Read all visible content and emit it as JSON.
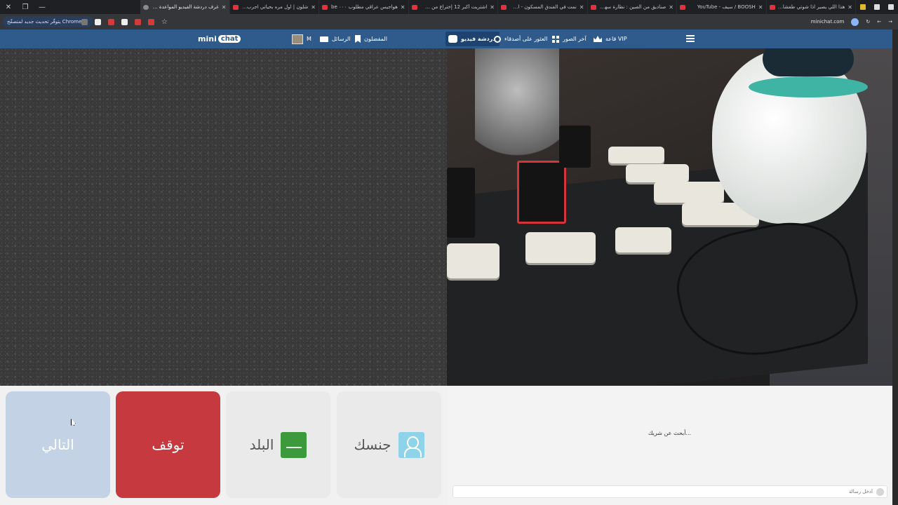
{
  "browser": {
    "tabs": [
      {
        "title": "هذا اللي يصير اذا شوتي طفشان ..."
      },
      {
        "title": "BOOSH / سيف - YouTube"
      },
      {
        "title": "صناديق من الصين : نظارة سهلة..."
      },
      {
        "title": "نمت في الفندق المسكون - اصوا..."
      },
      {
        "title": "اشتريت أكبر 12 إختراع من ش..."
      },
      {
        "title": "هواجيس عراقي مطلوب ٠٠٠ be"
      },
      {
        "title": "شلون | اول مره بحياتي اجرب سيار..."
      },
      {
        "title": "غرف دردشة الفيديو المواعدة بالفيديو"
      }
    ],
    "update_pill": "يتوفّر تحديث جديد لمتصفّح Chrome",
    "url": "minichat.com"
  },
  "site": {
    "logo": {
      "left": "mini",
      "right": "chat"
    },
    "nav": {
      "user_initial": "M",
      "messages": "الرسائل",
      "favorites": "المفضلون",
      "video_chat": "دردشة فيديو",
      "find_friends": "العثور على أصدقاء",
      "recent_photos": "آخر الصور",
      "vip": "قاعة VIP"
    }
  },
  "controls": {
    "next": "التالي",
    "stop": "توقف",
    "country": "البلد",
    "gender": "جنسك"
  },
  "chat": {
    "status": "...أبحث عن شريك",
    "input_placeholder": "أدخل رسالة"
  },
  "colors": {
    "nav_bg": "#2f5b8c",
    "stop": "#c6393f",
    "next": "#c3d2e4",
    "flag": "#3d9a3c",
    "gender_icon": "#8fd3e8"
  }
}
